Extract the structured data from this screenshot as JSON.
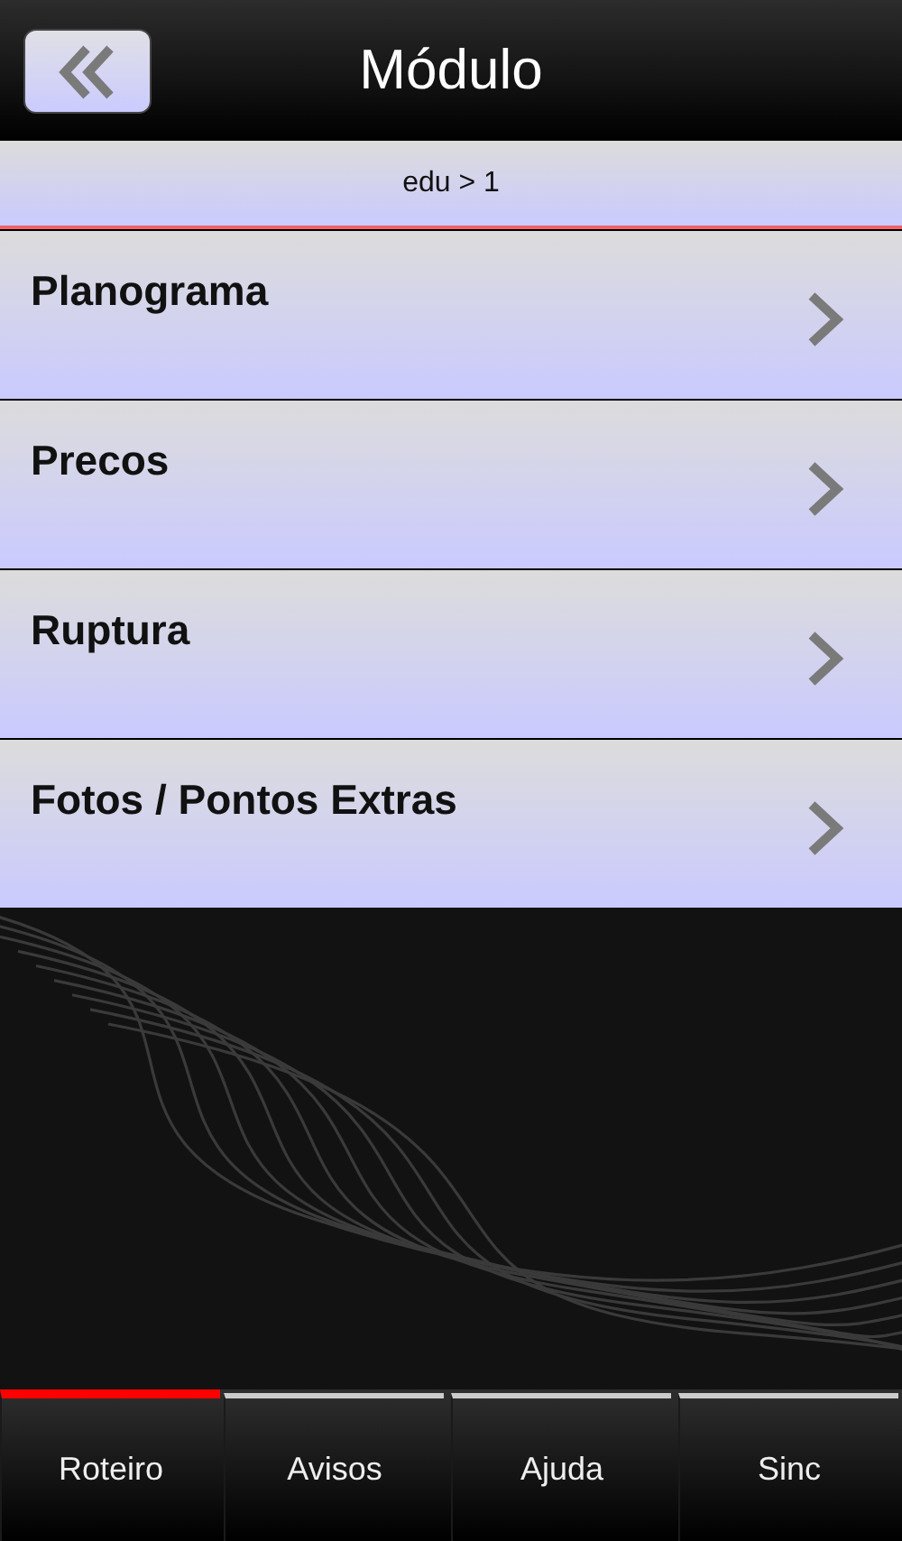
{
  "header": {
    "title": "Módulo"
  },
  "breadcrumb": "edu > 1",
  "items": [
    {
      "label": "Planograma"
    },
    {
      "label": "Precos"
    },
    {
      "label": "Ruptura"
    },
    {
      "label": "Fotos / Pontos Extras"
    }
  ],
  "tabs": [
    {
      "label": "Roteiro",
      "selected": true
    },
    {
      "label": "Avisos",
      "selected": false
    },
    {
      "label": "Ajuda",
      "selected": false
    },
    {
      "label": "Sinc",
      "selected": false
    }
  ]
}
